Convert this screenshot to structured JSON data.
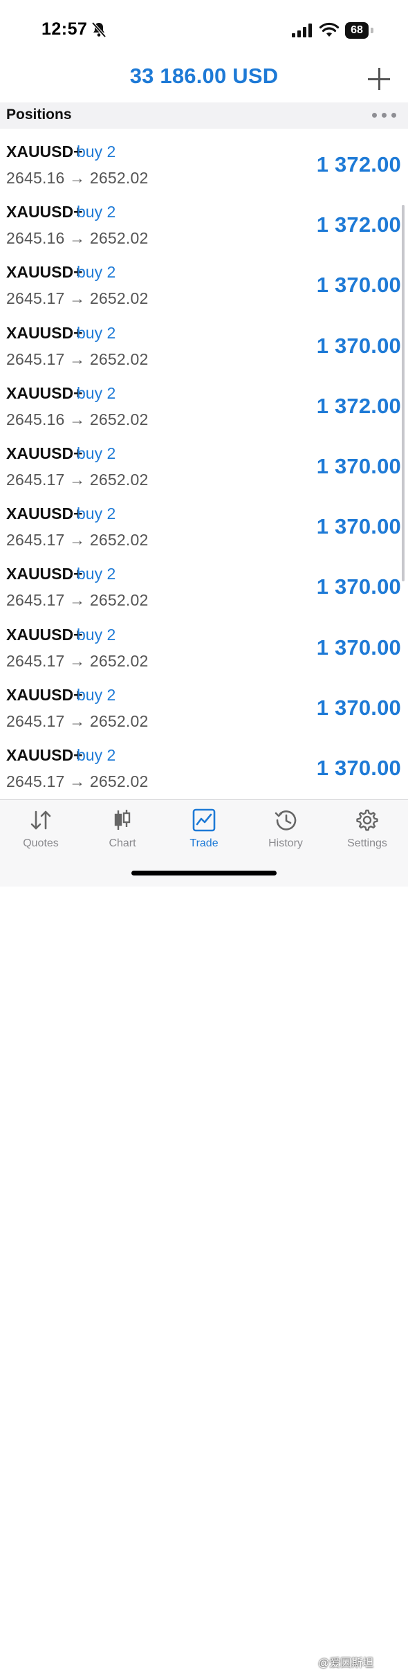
{
  "status_bar": {
    "time": "12:57",
    "battery": "68"
  },
  "header": {
    "balance": "33 186.00 USD"
  },
  "section": {
    "title": "Positions"
  },
  "positions": [
    {
      "symbol": "XAUUSD+",
      "side": "buy 2",
      "prices": "2645.16 → 2652.02",
      "profit": "1 372.00"
    },
    {
      "symbol": "XAUUSD+",
      "side": "buy 2",
      "prices": "2645.16 → 2652.02",
      "profit": "1 372.00"
    },
    {
      "symbol": "XAUUSD+",
      "side": "buy 2",
      "prices": "2645.17 → 2652.02",
      "profit": "1 370.00"
    },
    {
      "symbol": "XAUUSD+",
      "side": "buy 2",
      "prices": "2645.17 → 2652.02",
      "profit": "1 370.00"
    },
    {
      "symbol": "XAUUSD+",
      "side": "buy 2",
      "prices": "2645.16 → 2652.02",
      "profit": "1 372.00"
    },
    {
      "symbol": "XAUUSD+",
      "side": "buy 2",
      "prices": "2645.17 → 2652.02",
      "profit": "1 370.00"
    },
    {
      "symbol": "XAUUSD+",
      "side": "buy 2",
      "prices": "2645.17 → 2652.02",
      "profit": "1 370.00"
    },
    {
      "symbol": "XAUUSD+",
      "side": "buy 2",
      "prices": "2645.17 → 2652.02",
      "profit": "1 370.00"
    },
    {
      "symbol": "XAUUSD+",
      "side": "buy 2",
      "prices": "2645.17 → 2652.02",
      "profit": "1 370.00"
    },
    {
      "symbol": "XAUUSD+",
      "side": "buy 2",
      "prices": "2645.17 → 2652.02",
      "profit": "1 370.00"
    },
    {
      "symbol": "XAUUSD+",
      "side": "buy 2",
      "prices": "2645.17 → 2652.02",
      "profit": "1 370.00"
    }
  ],
  "tabs": [
    {
      "label": "Quotes",
      "icon": "quotes-arrows-icon"
    },
    {
      "label": "Chart",
      "icon": "candlestick-icon"
    },
    {
      "label": "Trade",
      "icon": "trade-chart-icon",
      "active": true
    },
    {
      "label": "History",
      "icon": "history-clock-icon"
    },
    {
      "label": "Settings",
      "icon": "gear-icon"
    }
  ],
  "watermark": "@爱因斯坦",
  "colors": {
    "accent": "#1e7ad6",
    "inactive": "#8a8a8e"
  }
}
